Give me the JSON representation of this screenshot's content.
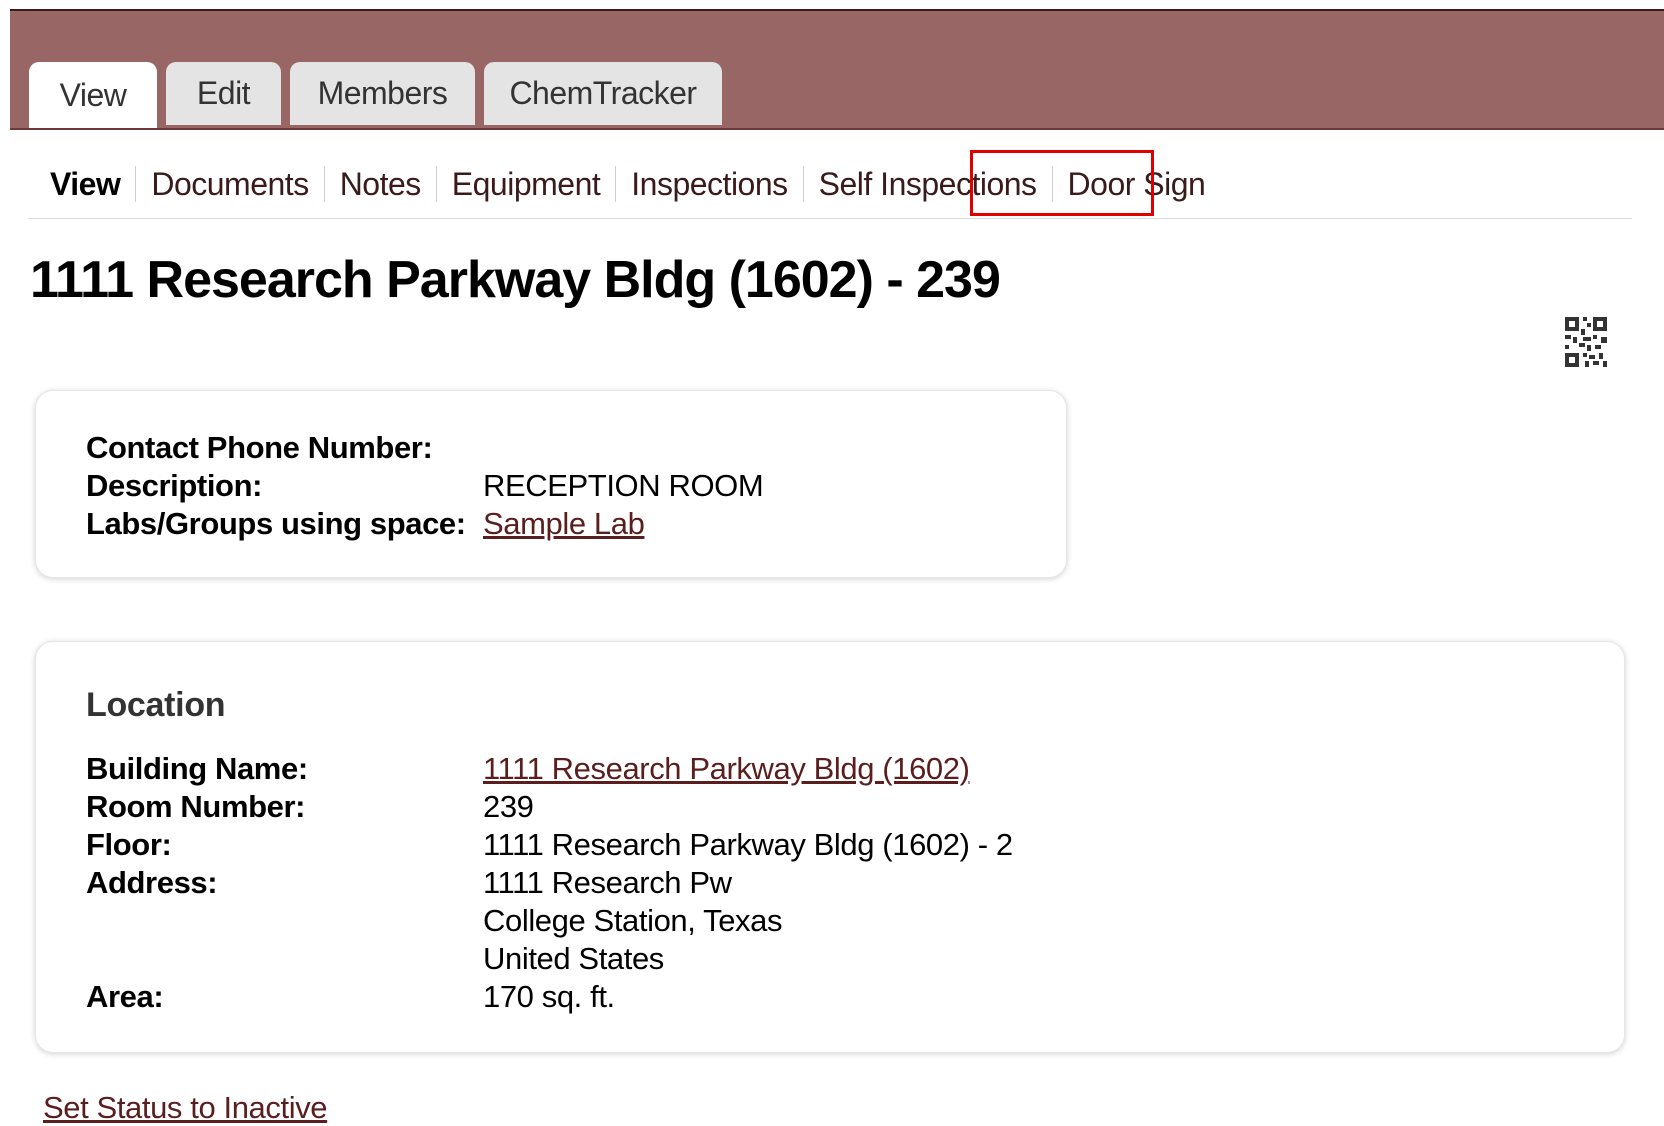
{
  "tabs": [
    {
      "label": "View",
      "active": true
    },
    {
      "label": "Edit",
      "active": false
    },
    {
      "label": "Members",
      "active": false
    },
    {
      "label": "ChemTracker",
      "active": false
    }
  ],
  "subnav": [
    {
      "label": "View",
      "active": true
    },
    {
      "label": "Documents"
    },
    {
      "label": "Notes"
    },
    {
      "label": "Equipment"
    },
    {
      "label": "Inspections"
    },
    {
      "label": "Self Inspections"
    },
    {
      "label": "Door Sign",
      "highlighted": true
    }
  ],
  "page_title": "1111 Research Parkway Bldg (1602) - 239",
  "qr_icon": "qr-code-icon",
  "info": {
    "contact_phone_label": "Contact Phone Number:",
    "contact_phone_value": "",
    "description_label": "Description:",
    "description_value": "RECEPTION ROOM",
    "labs_label": "Labs/Groups using space:",
    "labs_value": "Sample Lab"
  },
  "location": {
    "title": "Location",
    "building_label": "Building Name:",
    "building_value": "1111 Research Parkway Bldg (1602)",
    "room_label": "Room Number:",
    "room_value": "239",
    "floor_label": "Floor:",
    "floor_value": "1111 Research Parkway Bldg (1602) - 2",
    "address_label": "Address:",
    "address_line1": "1111 Research Pw",
    "address_line2": "College Station, Texas",
    "address_line3": "United States",
    "area_label": "Area:",
    "area_value": "170 sq. ft."
  },
  "footer": {
    "set_inactive": "Set Status to Inactive"
  },
  "colors": {
    "header": "#976665",
    "highlight": "#e00000",
    "link": "#5a1e1e"
  }
}
